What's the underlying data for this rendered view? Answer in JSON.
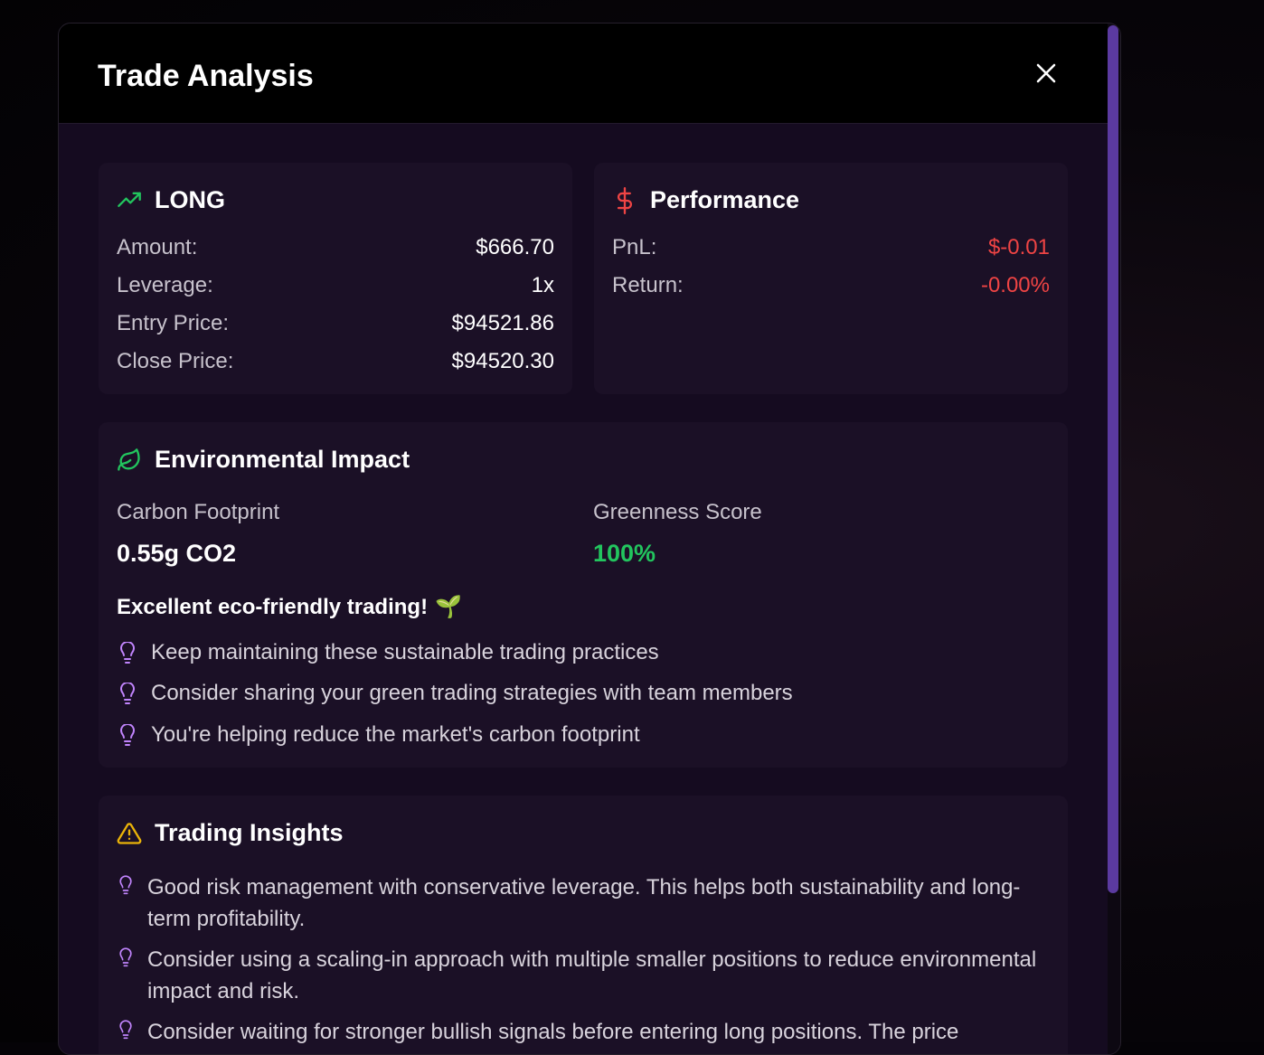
{
  "modal": {
    "title": "Trade Analysis",
    "close_icon": "close-icon"
  },
  "position": {
    "side": "LONG",
    "icon": "trending-up-icon",
    "rows": [
      {
        "label": "Amount:",
        "value": "$666.70"
      },
      {
        "label": "Leverage:",
        "value": "1x"
      },
      {
        "label": "Entry Price:",
        "value": "$94521.86"
      },
      {
        "label": "Close Price:",
        "value": "$94520.30"
      }
    ]
  },
  "performance": {
    "title": "Performance",
    "icon": "dollar-icon",
    "rows": [
      {
        "label": "PnL:",
        "value": "$-0.01"
      },
      {
        "label": "Return:",
        "value": "-0.00%"
      }
    ]
  },
  "environment": {
    "title": "Environmental Impact",
    "icon": "leaf-icon",
    "carbon_label": "Carbon Footprint",
    "carbon_value": "0.55g CO2",
    "score_label": "Greenness Score",
    "score_value": "100%",
    "message": "Excellent eco-friendly trading!",
    "message_emoji": "🌱",
    "tips": [
      "Keep maintaining these sustainable trading practices",
      "Consider sharing your green trading strategies with team members",
      "You're helping reduce the market's carbon footprint"
    ]
  },
  "insights": {
    "title": "Trading Insights",
    "icon": "warning-icon",
    "items": [
      "Good risk management with conservative leverage. This helps both sustainability and long-term profitability.",
      "Consider using a scaling-in approach with multiple smaller positions to reduce environmental impact and risk.",
      "Consider waiting for stronger bullish signals before entering long positions. The price"
    ]
  },
  "colors": {
    "accent_green": "#22c55e",
    "negative_red": "#ef4444",
    "tip_purple": "#c084fc",
    "warning_yellow": "#eab308",
    "scrollbar": "#5b3aa0"
  }
}
